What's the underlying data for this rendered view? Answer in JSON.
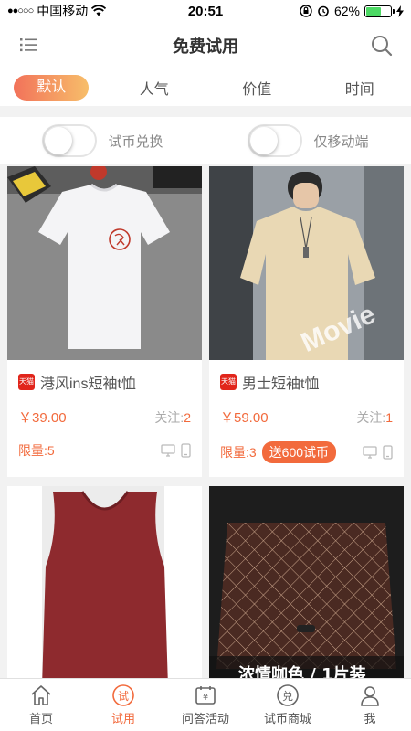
{
  "status_bar": {
    "carrier": "中国移动",
    "time": "20:51",
    "battery": "62%",
    "battery_level": 0.62
  },
  "nav": {
    "title": "免费试用"
  },
  "tabs": [
    {
      "label": "默认",
      "active": true
    },
    {
      "label": "人气",
      "active": false
    },
    {
      "label": "价值",
      "active": false
    },
    {
      "label": "时间",
      "active": false
    }
  ],
  "toggles": [
    {
      "label": "试币兑换",
      "on": false
    },
    {
      "label": "仅移动端",
      "on": false
    }
  ],
  "products": [
    {
      "title": "港风ins短袖t恤",
      "price": "￥39.00",
      "follow_label": "关注:",
      "follow_count": "2",
      "limit_label": "限量:",
      "limit_count": "5",
      "bonus": ""
    },
    {
      "title": "男士短袖t恤",
      "price": "￥59.00",
      "follow_label": "关注:",
      "follow_count": "1",
      "limit_label": "限量:",
      "limit_count": "3",
      "bonus": "送600试币"
    }
  ],
  "mat_overlay_text": "浓情咖色 / 1片装",
  "tabbar": [
    {
      "label": "首页",
      "icon": "home-icon",
      "active": false
    },
    {
      "label": "试用",
      "icon": "trial-icon",
      "active": true
    },
    {
      "label": "问答活动",
      "icon": "qa-icon",
      "active": false
    },
    {
      "label": "试币商城",
      "icon": "coin-mall-icon",
      "active": false
    },
    {
      "label": "我",
      "icon": "profile-icon",
      "active": false
    }
  ],
  "colors": {
    "accent": "#f26a3c",
    "gradient_start": "#f2725a",
    "gradient_end": "#f7be6a"
  }
}
